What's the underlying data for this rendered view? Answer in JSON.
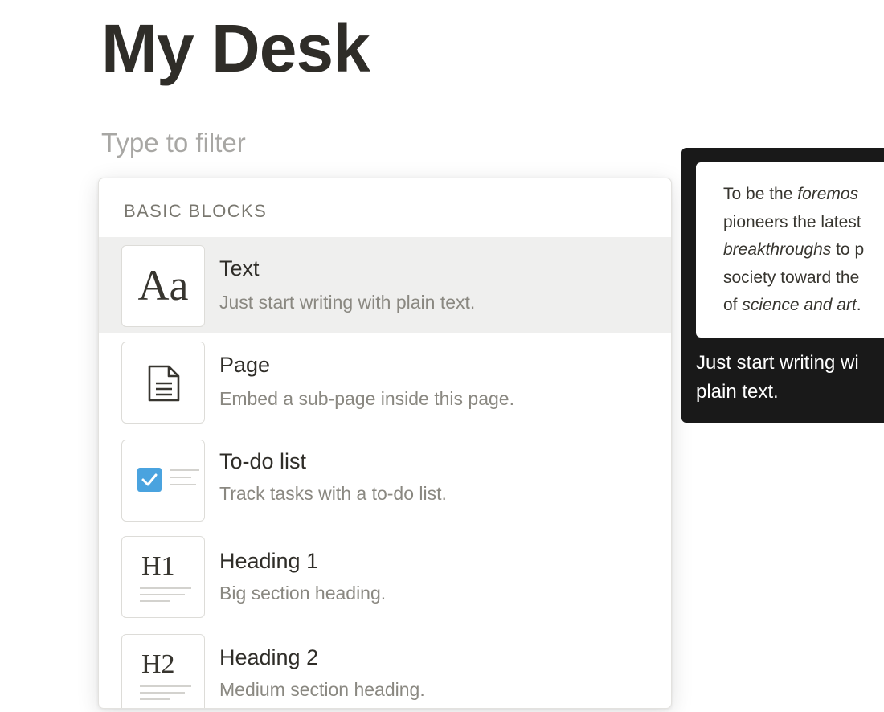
{
  "page": {
    "title": "My Desk"
  },
  "filter": {
    "placeholder": "Type to filter"
  },
  "menu": {
    "section_label": "BASIC BLOCKS",
    "items": [
      {
        "title": "Text",
        "description": "Just start writing with plain text.",
        "icon": "text-aa-icon",
        "thumb_text": "Aa",
        "selected": true
      },
      {
        "title": "Page",
        "description": "Embed a sub-page inside this page.",
        "icon": "page-icon"
      },
      {
        "title": "To-do list",
        "description": "Track tasks with a to-do list.",
        "icon": "todo-checkbox-icon"
      },
      {
        "title": "Heading 1",
        "description": "Big section heading.",
        "icon": "heading1-icon",
        "thumb_text": "H1"
      },
      {
        "title": "Heading 2",
        "description": "Medium section heading.",
        "icon": "heading2-icon",
        "thumb_text": "H2"
      }
    ]
  },
  "preview": {
    "lines": [
      [
        "To be the ",
        "foremos"
      ],
      [
        "pioneers the latest",
        ""
      ],
      [
        "",
        "breakthroughs",
        " to p"
      ],
      [
        "society toward the",
        ""
      ],
      [
        "of ",
        "science and art",
        "."
      ]
    ],
    "caption_lines": [
      "Just start writing wi",
      "plain text."
    ]
  },
  "colors": {
    "accent_checkbox": "#4aa3df",
    "selected_row": "#efefee",
    "preview_bg": "#191919"
  }
}
